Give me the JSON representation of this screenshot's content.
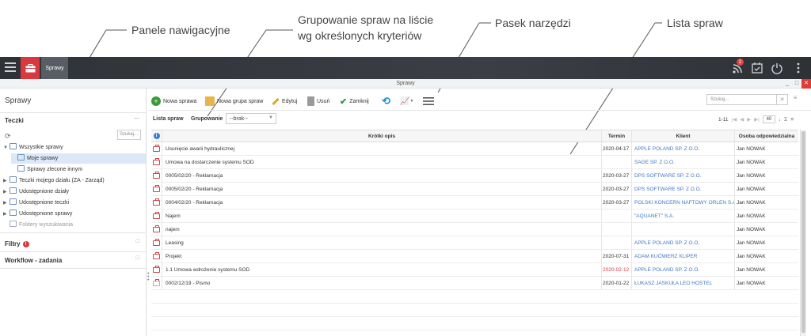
{
  "annotations": {
    "nav_panels": "Panele nawigacyjne",
    "grouping_line1": "Grupowanie spraw na liście",
    "grouping_line2": "wg określonych kryteriów",
    "toolbar": "Pasek narzędzi",
    "case_list": "Lista spraw"
  },
  "topbar": {
    "app_tab": "Sprawy",
    "notification_count": "2"
  },
  "window": {
    "title": "Sprawy",
    "minimize": "_",
    "maximize": "□",
    "close": "✕"
  },
  "leftpanel": {
    "title": "Sprawy",
    "folders_header": "Teczki",
    "folders_minimize": "—",
    "search_placeholder": "Szukaj...",
    "tree": [
      {
        "label": "Wszystkie sprawy",
        "arrow": "▼"
      },
      {
        "label": "Moje sprawy",
        "arrow": ""
      },
      {
        "label": "Sprawy zlecone innym",
        "arrow": ""
      },
      {
        "label": "Teczki mojego działu (ZA - Zarząd)",
        "arrow": "▶"
      },
      {
        "label": "Udostępnione działy",
        "arrow": "▶"
      },
      {
        "label": "Udostępnione teczki",
        "arrow": "▶"
      },
      {
        "label": "Udostępnione sprawy",
        "arrow": "▶"
      },
      {
        "label": "Foldery wyszukiwania",
        "arrow": ""
      }
    ],
    "filters_header": "Filtry",
    "filters_alert": "!",
    "workflow_header": "Workflow - zadania"
  },
  "toolbar": {
    "new_case": "Nowa sprawa",
    "new_group": "Nowa grupa spraw",
    "edit": "Edytuj",
    "delete": "Usuń",
    "close": "Zamknij",
    "search_placeholder": "Szukaj..."
  },
  "listbar": {
    "title": "Lista spraw",
    "grouping_label": "Grupowanie",
    "grouping_value": "--brak--",
    "range": "1-11",
    "page_size": "40"
  },
  "table": {
    "headers": {
      "desc": "Krótki opis",
      "term": "Termin",
      "client": "Klient",
      "person": "Osoba odpowiedzialna"
    },
    "rows": [
      {
        "desc": "Usunięcie awarii hydraulicznej",
        "term": "2020-04-17",
        "client": "APPLE POLAND SP. Z O.O.",
        "person": "Jan NOWAK"
      },
      {
        "desc": "Umowa na dostarczenie systemu SOD",
        "term": "",
        "client": "SAGE SP. Z O.O.",
        "person": "Jan NOWAK"
      },
      {
        "desc": "0005/02/20 - Reklamacja",
        "term": "2020-03-27",
        "client": "DPS SOFTWARE SP. Z O.O.",
        "person": "Jan NOWAK"
      },
      {
        "desc": "0005/02/20 - Reklamacja",
        "term": "2020-03-27",
        "client": "DPS SOFTWARE SP. Z O.O.",
        "person": "Jan NOWAK"
      },
      {
        "desc": "0004/02/20 - Reklamacja",
        "term": "2020-03-27",
        "client": "POLSKI KONCERN NAFTOWY ORLEN S.A.",
        "person": "Jan NOWAK"
      },
      {
        "desc": "Najem",
        "term": "",
        "client": "\"AQUANET\" S.A.",
        "person": "Jan NOWAK"
      },
      {
        "desc": "najem",
        "term": "",
        "client": "",
        "person": "Jan NOWAK"
      },
      {
        "desc": "Leasing",
        "term": "",
        "client": "APPLE POLAND SP. Z O.O.",
        "person": "Jan NOWAK"
      },
      {
        "desc": "Projekt",
        "term": "2020-07-31",
        "client": "ADAM KUĆMIERZ KLIPER",
        "person": "Jan NOWAK"
      },
      {
        "desc": "1.1 Umowa wdrożenie systemu SOD",
        "term": "2020-02-12",
        "client": "APPLE POLAND SP. Z O.O.",
        "person": "Jan NOWAK"
      },
      {
        "desc": "0002/12/19 - Pismo",
        "term": "2020-01-22",
        "client": "ŁUKASZ JASKUŁA LEO HOSTEL",
        "person": "Jan NOWAK"
      }
    ]
  },
  "colors": {
    "accent": "#d9393e",
    "link": "#3f78c9",
    "selected": "#dbe8f7"
  }
}
